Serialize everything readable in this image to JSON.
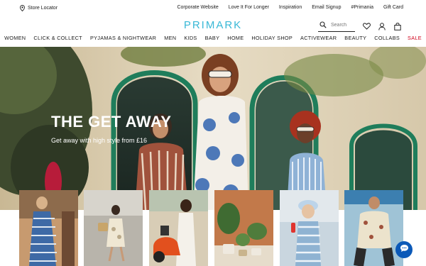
{
  "utility": {
    "store_locator": "Store Locator",
    "links": [
      "Corporate Website",
      "Love It For Longer",
      "Inspiration",
      "Email Signup",
      "#Primania",
      "Gift Card"
    ]
  },
  "header": {
    "logo": "PRIMARK",
    "search_placeholder": "Search",
    "brand_color": "#38b8d6"
  },
  "nav": {
    "items": [
      "WOMEN",
      "CLICK & COLLECT",
      "PYJAMAS & NIGHTWEAR",
      "MEN",
      "KIDS",
      "BABY",
      "HOME",
      "HOLIDAY SHOP",
      "ACTIVEWEAR",
      "BEAUTY",
      "COLLABS",
      "SALE"
    ],
    "sale_color": "#d0021b"
  },
  "hero": {
    "title": "THE GET AWAY",
    "subtitle": "Get away with high style from £16"
  },
  "tiles": {
    "selected_index": 2,
    "highlight_color": "#9ae23c"
  },
  "icons": {
    "store": "location-pin-icon",
    "search": "search-icon",
    "wishlist": "heart-icon",
    "account": "user-icon",
    "basket": "shopping-bag-icon",
    "chat": "chat-bubble-icon"
  }
}
